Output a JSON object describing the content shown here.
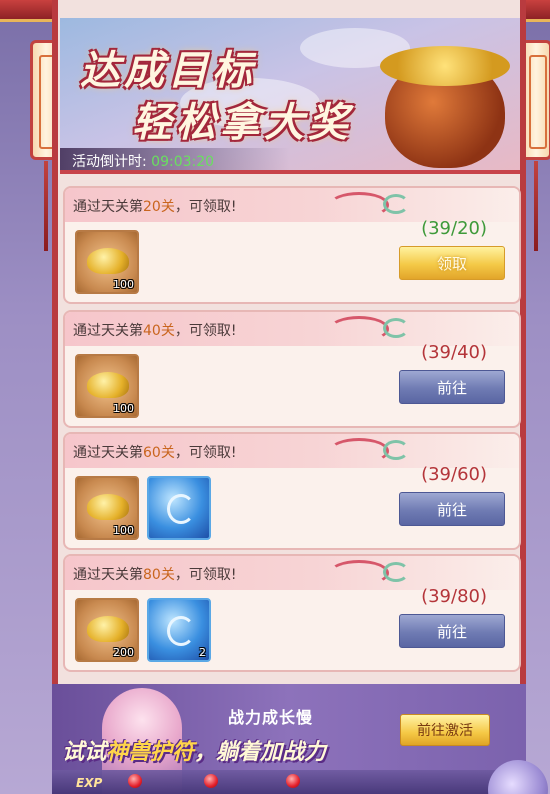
{
  "banner": {
    "title_line1": "达成目标",
    "title_line2": "轻松拿大奖",
    "countdown_label": "活动倒计时:",
    "countdown_value": "09:03:20"
  },
  "tasks": [
    {
      "prefix": "通过天关第",
      "num": "20关",
      "suffix": "，可领取!",
      "progress": "(39/20)",
      "status": "done",
      "button": "领取",
      "items": [
        {
          "type": "gold-ingot-icon",
          "qty": "100"
        }
      ]
    },
    {
      "prefix": "通过天关第",
      "num": "40关",
      "suffix": "，可领取!",
      "progress": "(39/40)",
      "status": "todo",
      "button": "前往",
      "items": [
        {
          "type": "gold-ingot-icon",
          "qty": "100"
        }
      ]
    },
    {
      "prefix": "通过天关第",
      "num": "60关",
      "suffix": "，可领取!",
      "progress": "(39/60)",
      "status": "todo",
      "button": "前往",
      "items": [
        {
          "type": "gold-ingot-icon",
          "qty": "100"
        },
        {
          "type": "divine-beast-talisman-icon",
          "qty": ""
        }
      ]
    },
    {
      "prefix": "通过天关第",
      "num": "80关",
      "suffix": "，可领取!",
      "progress": "(39/80)",
      "status": "todo",
      "button": "前往",
      "items": [
        {
          "type": "gold-ingot-icon",
          "qty": "200"
        },
        {
          "type": "divine-beast-talisman-icon",
          "qty": "2"
        }
      ]
    }
  ],
  "ad": {
    "line1": "战力成长慢",
    "line2_a": "试试",
    "line2_hl": "神兽护符",
    "line2_b": "，躺着加战力",
    "button": "前往激活"
  },
  "bottom_bar": {
    "exp_label": "EXP"
  },
  "colors": {
    "frame_red": "#b93b3f",
    "progress_done": "#3e9a3a",
    "progress_todo": "#b4353a",
    "countdown_green": "#69e05f"
  }
}
